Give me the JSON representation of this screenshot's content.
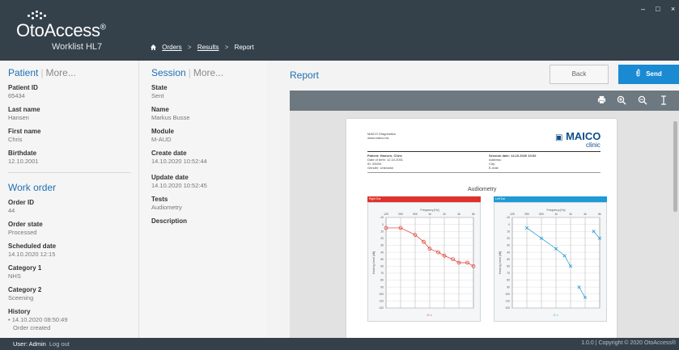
{
  "app": {
    "name": "OtoAccess",
    "registered": "®",
    "subtitle": "Worklist HL7"
  },
  "window_controls": {
    "minimize": "–",
    "maximize": "□",
    "close": "×"
  },
  "breadcrumb": {
    "items": [
      "Orders",
      "Results",
      "Report"
    ],
    "separator": ">"
  },
  "patient": {
    "heading": "Patient",
    "more": "More...",
    "fields": [
      {
        "label": "Patient ID",
        "value": "65434"
      },
      {
        "label": "Last name",
        "value": "Hansen"
      },
      {
        "label": "First name",
        "value": "Chris"
      },
      {
        "label": "Birthdate",
        "value": "12.10.2001"
      }
    ]
  },
  "work_order": {
    "heading": "Work order",
    "fields": [
      {
        "label": "Order ID",
        "value": "44"
      },
      {
        "label": "Order state",
        "value": "Processed"
      },
      {
        "label": "Scheduled date",
        "value": "14.10.2020 12:15"
      },
      {
        "label": "Category 1",
        "value": "NHS"
      },
      {
        "label": "Category 2",
        "value": "Sceening"
      }
    ],
    "history": {
      "label": "History",
      "entries": [
        "• 14.10.2020 08:50:49",
        "Order created"
      ]
    }
  },
  "session": {
    "heading": "Session",
    "more": "More...",
    "fields": [
      {
        "label": "State",
        "value": "Sent"
      },
      {
        "label": "Name",
        "value": "Markus Busse"
      },
      {
        "label": "Module",
        "value": "M-AUD"
      },
      {
        "label": "Create date",
        "value": "14.10.2020 10:52:44"
      },
      {
        "label": "Update date",
        "value": "14.10.2020 10:52:45"
      },
      {
        "label": "Tests",
        "value": "Audiometry"
      },
      {
        "label": "Description",
        "value": ""
      }
    ]
  },
  "report": {
    "heading": "Report",
    "back_label": "Back",
    "send_label": "Send",
    "toolbar_icons": [
      "print-icon",
      "zoom-in-icon",
      "zoom-out-icon",
      "text-select-icon"
    ]
  },
  "document": {
    "company": "MAICO Diagnostics",
    "website": "www.maico.biz",
    "brand": "MAICO",
    "brand_sub": "clinic",
    "patient_line": "Patient: Hansen, Chris",
    "dob_line": "Date of birth:  12.10.2001",
    "id_line": "ID:             65434",
    "gender_line": "Gender:       Unknown",
    "session_line": "Session date: 14.10.2020 10:52",
    "address_label": "Address:",
    "city_label": "City:",
    "email_label": "E-mail:",
    "chart_title": "Audiometry",
    "right_ear": "Right Ear",
    "left_ear": "Left Ear",
    "freq_label": "Frequency [Hz]",
    "y_label": "Hearing Level [dB]",
    "freq_ticks": [
      "125",
      "250",
      "500",
      "1k",
      "2k",
      "4k",
      "8k"
    ],
    "db_ticks": [
      "-10",
      "0",
      "10",
      "20",
      "30",
      "40",
      "50",
      "60",
      "70",
      "80",
      "90",
      "100",
      "110",
      "120"
    ],
    "colors": {
      "right": "#e0322b",
      "left": "#1e9ad6"
    }
  },
  "chart_data": [
    {
      "type": "line",
      "title": "Right Ear",
      "xlabel": "Frequency [Hz]",
      "ylabel": "Hearing Level [dB]",
      "ylim": [
        -10,
        120
      ],
      "y_inverted": true,
      "series": [
        {
          "x": [
            125,
            250,
            500,
            750,
            1000,
            1500,
            2000,
            3000,
            4000,
            6000,
            8000
          ],
          "values": [
            5,
            5,
            15,
            25,
            35,
            40,
            45,
            50,
            55,
            55,
            60
          ]
        }
      ]
    },
    {
      "type": "line",
      "title": "Left Ear",
      "xlabel": "Frequency [Hz]",
      "ylabel": "Hearing Level [dB]",
      "ylim": [
        -10,
        120
      ],
      "y_inverted": true,
      "series": [
        {
          "x": [
            250,
            500,
            1000,
            1500,
            2000
          ],
          "values": [
            5,
            20,
            35,
            45,
            60
          ]
        },
        {
          "x": [
            3000,
            4000
          ],
          "values": [
            90,
            105
          ]
        },
        {
          "x": [
            6000,
            8000
          ],
          "values": [
            10,
            20
          ]
        }
      ]
    }
  ],
  "footer": {
    "user": "User: Admin",
    "logout": "Log out",
    "copyright": "1.0.0 | Copyright © 2020 OtoAccess®"
  }
}
